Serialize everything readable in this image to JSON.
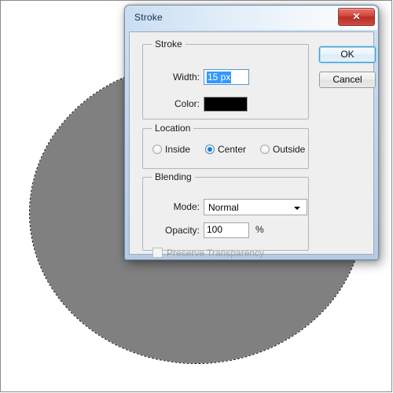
{
  "canvas": {
    "shape_name": "elliptical-selection",
    "fill_color": "#808080",
    "background_color": "#ffffff"
  },
  "dialog": {
    "title": "Stroke",
    "close_label": "✕",
    "buttons": {
      "ok": "OK",
      "cancel": "Cancel"
    },
    "stroke_group": {
      "title": "Stroke",
      "width_label": "Width:",
      "width_value": "15 px",
      "color_label": "Color:",
      "color_value": "#000000"
    },
    "location_group": {
      "title": "Location",
      "options": [
        {
          "label": "Inside",
          "checked": false
        },
        {
          "label": "Center",
          "checked": true
        },
        {
          "label": "Outside",
          "checked": false
        }
      ]
    },
    "blending_group": {
      "title": "Blending",
      "mode_label": "Mode:",
      "mode_value": "Normal",
      "opacity_label": "Opacity:",
      "opacity_value": "100",
      "opacity_unit": "%",
      "preserve_label": "Preserve Transparency",
      "preserve_checked": false
    }
  }
}
